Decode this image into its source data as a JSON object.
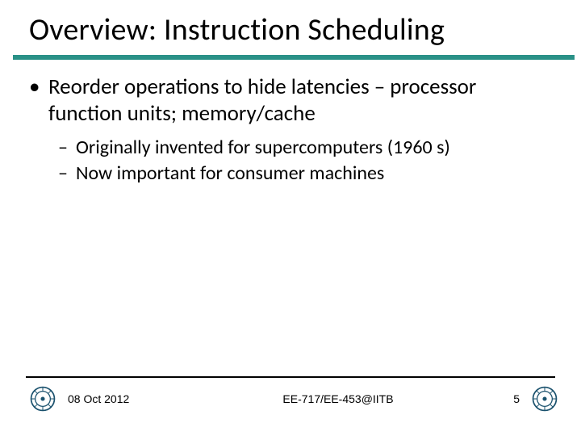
{
  "title": "Overview: Instruction Scheduling",
  "bullets": [
    {
      "marker": "•",
      "text": "Reorder operations to hide latencies – processor function units; memory/cache",
      "sub": [
        {
          "marker": "–",
          "text": "Originally invented for supercomputers (1960 s)"
        },
        {
          "marker": "–",
          "text": "Now important for consumer machines"
        }
      ]
    }
  ],
  "footer": {
    "date": "08 Oct 2012",
    "center": "EE-717/EE-453@IITB",
    "page": "5"
  },
  "colors": {
    "accent": "#2a9187"
  }
}
